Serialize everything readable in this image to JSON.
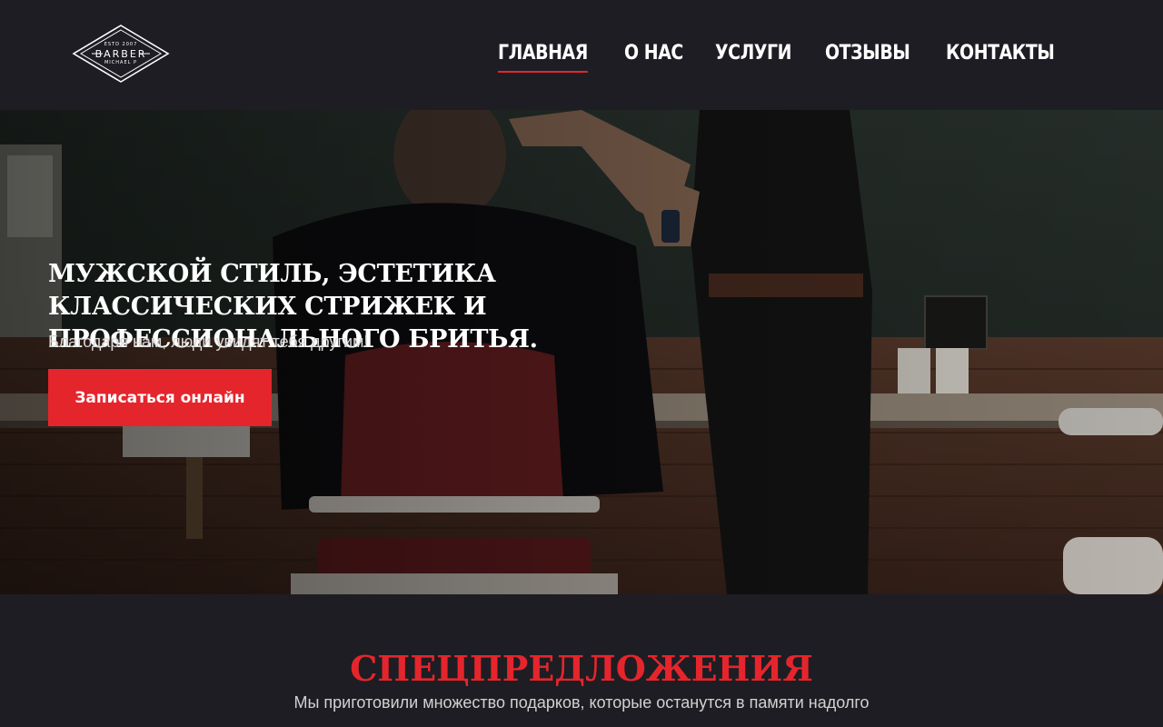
{
  "header": {
    "logo": {
      "top_text": "ESTD 2007",
      "main_text": "BARBER",
      "bottom_text": "MICHAEL P"
    },
    "nav": [
      {
        "label": "ГЛАВНАЯ",
        "active": true
      },
      {
        "label": "О НАС",
        "active": false
      },
      {
        "label": "УСЛУГИ",
        "active": false
      },
      {
        "label": "ОТЗЫВЫ",
        "active": false
      },
      {
        "label": "КОНТАКТЫ",
        "active": false
      }
    ]
  },
  "hero": {
    "title": "МУЖСКОЙ СТИЛЬ, ЭСТЕТИКА КЛАССИЧЕСКИХ СТРИЖЕК И ПРОФЕССИОНАЛЬНОГО БРИТЬЯ.",
    "subtitle": "Благодаря нам, люди увидят тебя другим!",
    "cta_label": "Записаться онлайн"
  },
  "offers": {
    "title": "СПЕЦПРЕДЛОЖЕНИЯ",
    "subtitle": "Мы приготовили множество подарков, которые останутся в памяти надолго"
  },
  "colors": {
    "background": "#1e1d23",
    "accent": "#e5252c",
    "text": "#ffffff"
  },
  "icons": [
    "barber-logo-icon"
  ]
}
